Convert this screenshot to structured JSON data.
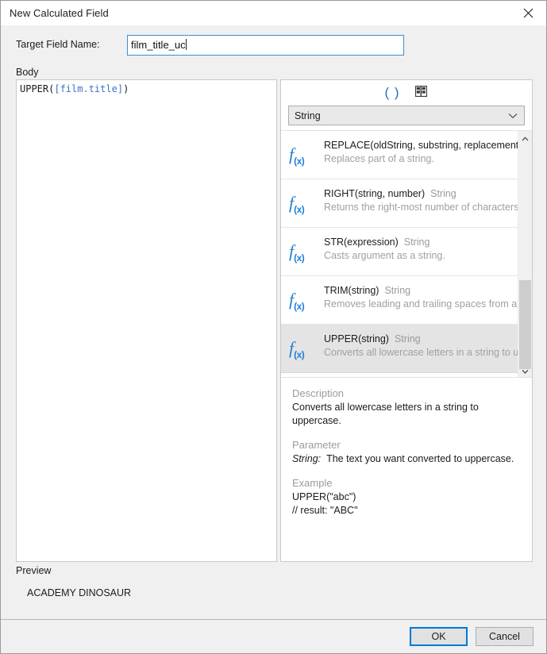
{
  "window": {
    "title": "New Calculated Field",
    "close_icon": "close-icon"
  },
  "form": {
    "target_field_label": "Target Field Name:",
    "target_field_value": "film_title_uc",
    "target_field_placeholder": "",
    "body_label": "Body",
    "body_code_prefix": "UPPER(",
    "body_code_fieldref": "[film.title]",
    "body_code_suffix": ")"
  },
  "function_panel": {
    "toolbar": {
      "functions_icon": "parentheses-icon",
      "fields_icon": "fields-grid-icon"
    },
    "category_select": {
      "value": "String",
      "chevron_icon": "chevron-down-icon"
    },
    "items": [
      {
        "signature": "REPLACE(oldString, substring, replacement)",
        "return_type": "String",
        "description": "Replaces part of a string.",
        "selected": false
      },
      {
        "signature": "RIGHT(string, number)",
        "return_type": "String",
        "description": "Returns the right-most number of characters in a string.",
        "selected": false
      },
      {
        "signature": "STR(expression)",
        "return_type": "String",
        "description": "Casts argument as a string.",
        "selected": false
      },
      {
        "signature": "TRIM(string)",
        "return_type": "String",
        "description": "Removes leading and trailing spaces from a string.",
        "selected": false
      },
      {
        "signature": "UPPER(string)",
        "return_type": "String",
        "description": "Converts all lowercase letters in a string to uppercase.",
        "selected": true
      }
    ],
    "scrollbar": {
      "up_icon": "chevron-up-icon",
      "down_icon": "chevron-down-icon"
    },
    "detail": {
      "description_heading": "Description",
      "description_text": "Converts all lowercase letters in a string to uppercase.",
      "parameter_heading": "Parameter",
      "parameter_name": "String:",
      "parameter_text": "The text you want converted to uppercase.",
      "example_heading": "Example",
      "example_line1": "UPPER(\"abc\")",
      "example_line2": "// result: \"ABC\""
    }
  },
  "preview": {
    "label": "Preview",
    "value": "ACADEMY DINOSAUR"
  },
  "footer": {
    "ok_label": "OK",
    "cancel_label": "Cancel"
  },
  "colors": {
    "accent": "#0078d7",
    "field_focus_border": "#3b8fd0",
    "code_fieldref": "#3a74c8",
    "fx_icon": "#1f7fd6",
    "muted_text": "#a0a0a0"
  }
}
